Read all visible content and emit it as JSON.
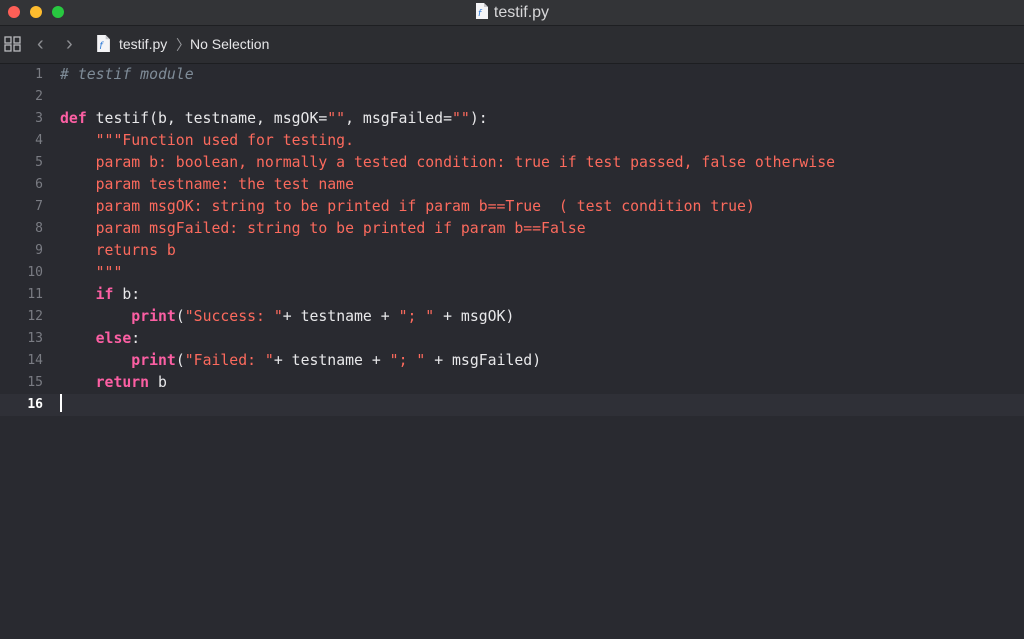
{
  "window": {
    "title": "testif.py"
  },
  "jumpbar": {
    "file": "testif.py",
    "selection": "No Selection"
  },
  "editor": {
    "current_line": 16,
    "lines": [
      {
        "n": "1",
        "tokens": [
          {
            "t": "comment",
            "v": "# testif module"
          }
        ]
      },
      {
        "n": "2",
        "tokens": []
      },
      {
        "n": "3",
        "tokens": [
          {
            "t": "kw",
            "v": "def"
          },
          {
            "t": "plain",
            "v": " testif(b, testname, msgOK="
          },
          {
            "t": "str",
            "v": "\"\""
          },
          {
            "t": "plain",
            "v": ", msgFailed="
          },
          {
            "t": "str",
            "v": "\"\""
          },
          {
            "t": "plain",
            "v": "):"
          }
        ]
      },
      {
        "n": "4",
        "tokens": [
          {
            "t": "str",
            "v": "    \"\"\"Function used for testing."
          }
        ]
      },
      {
        "n": "5",
        "tokens": [
          {
            "t": "str",
            "v": "    param b: boolean, normally a tested condition: true if test passed, false otherwise"
          }
        ]
      },
      {
        "n": "6",
        "tokens": [
          {
            "t": "str",
            "v": "    param testname: the test name"
          }
        ]
      },
      {
        "n": "7",
        "tokens": [
          {
            "t": "str",
            "v": "    param msgOK: string to be printed if param b==True  ( test condition true)"
          }
        ]
      },
      {
        "n": "8",
        "tokens": [
          {
            "t": "str",
            "v": "    param msgFailed: string to be printed if param b==False"
          }
        ]
      },
      {
        "n": "9",
        "tokens": [
          {
            "t": "str",
            "v": "    returns b"
          }
        ]
      },
      {
        "n": "10",
        "tokens": [
          {
            "t": "str",
            "v": "    \"\"\""
          }
        ]
      },
      {
        "n": "11",
        "tokens": [
          {
            "t": "plain",
            "v": "    "
          },
          {
            "t": "kw",
            "v": "if"
          },
          {
            "t": "plain",
            "v": " b:"
          }
        ]
      },
      {
        "n": "12",
        "tokens": [
          {
            "t": "plain",
            "v": "        "
          },
          {
            "t": "kw",
            "v": "print"
          },
          {
            "t": "plain",
            "v": "("
          },
          {
            "t": "str",
            "v": "\"Success: \""
          },
          {
            "t": "plain",
            "v": "+ testname + "
          },
          {
            "t": "str",
            "v": "\"; \""
          },
          {
            "t": "plain",
            "v": " + msgOK)"
          }
        ]
      },
      {
        "n": "13",
        "tokens": [
          {
            "t": "plain",
            "v": "    "
          },
          {
            "t": "kw",
            "v": "else"
          },
          {
            "t": "plain",
            "v": ":"
          }
        ]
      },
      {
        "n": "14",
        "tokens": [
          {
            "t": "plain",
            "v": "        "
          },
          {
            "t": "kw",
            "v": "print"
          },
          {
            "t": "plain",
            "v": "("
          },
          {
            "t": "str",
            "v": "\"Failed: \""
          },
          {
            "t": "plain",
            "v": "+ testname + "
          },
          {
            "t": "str",
            "v": "\"; \""
          },
          {
            "t": "plain",
            "v": " + msgFailed)"
          }
        ]
      },
      {
        "n": "15",
        "tokens": [
          {
            "t": "plain",
            "v": "    "
          },
          {
            "t": "kw",
            "v": "return"
          },
          {
            "t": "plain",
            "v": " b"
          }
        ]
      },
      {
        "n": "16",
        "tokens": []
      }
    ]
  },
  "colors": {
    "background": "#292a30",
    "keyword": "#fc5fa3",
    "string": "#fc6a5d",
    "comment": "#7f8c98",
    "plain": "#e8e8ea"
  }
}
